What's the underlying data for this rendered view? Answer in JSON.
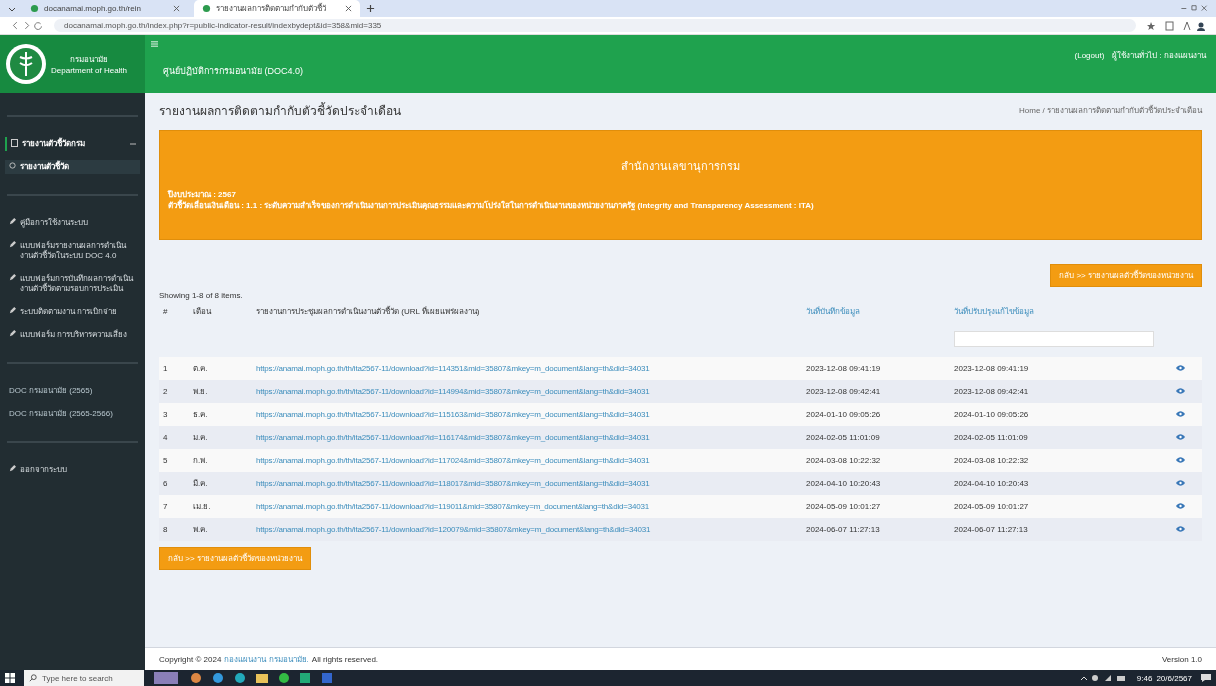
{
  "browser": {
    "tabs": [
      {
        "title": "docanamai.moph.go.th/rein",
        "selected": false
      },
      {
        "title": "รายงานผลการติดตามกำกับตัวชี้วั",
        "selected": true
      }
    ],
    "address": "docanamai.moph.go.th/index.php?r=public-indicator-result/indexbydept&id=358&mid=335"
  },
  "header": {
    "org_name": "กรมอนามัย",
    "org_name_en": "Department of Health",
    "app_title": "ศูนย์ปฏิบัติการกรมอนามัย (DOC4.0)",
    "logout": "(Logout)",
    "user": "ผู้ใช้งานทั่วไป : กองแผนงาน"
  },
  "sidebar": {
    "sections": [
      {
        "items": [
          {
            "label": "รายงานตัวชี้วัดกรม",
            "selected": false,
            "kind": "parent"
          },
          {
            "label": "รายงานตัวชี้วัด",
            "selected": true,
            "kind": "child"
          }
        ]
      },
      {
        "items": [
          {
            "label": "คู่มือการใช้งานระบบ",
            "selected": false,
            "kind": "link"
          },
          {
            "label": "แบบฟอร์มรายงานผลการดำเนินงานตัวชี้วัดในระบบ DOC 4.0",
            "selected": false,
            "kind": "link"
          },
          {
            "label": "แบบฟอร์มการบันทึกผลการดำเนินงานตัวชี้วัดตามรอบการประเมิน",
            "selected": false,
            "kind": "link"
          },
          {
            "label": "ระบบติดตามงาน การเบิกจ่าย",
            "selected": false,
            "kind": "link"
          },
          {
            "label": "แบบฟอร์ม การบริหารความเสี่ยง",
            "selected": false,
            "kind": "link"
          }
        ]
      },
      {
        "items": [
          {
            "label": "DOC กรมอนามัย (2565)",
            "selected": false,
            "kind": "plain"
          },
          {
            "label": "DOC กรมอนามัย (2565-2566)",
            "selected": false,
            "kind": "plain"
          }
        ]
      },
      {
        "items": [
          {
            "label": "ออกจากระบบ",
            "selected": false,
            "kind": "link"
          }
        ]
      }
    ]
  },
  "page": {
    "title": "รายงานผลการติดตามกำกับตัวชี้วัดประจำเดือน",
    "breadcrumb": "Home / รายงานผลการติดตามกำกับตัวชี้วัดประจำเดือน"
  },
  "banner": {
    "title": "สำนักงานเลขานุการกรม",
    "fiscal_year": "ปีงบประมาณ : 2567",
    "indicator": "ตัวชี้วัดเลื่อนเงินเดือน : 1.1 : ระดับความสำเร็จของการดำเนินงานการประเมินคุณธรรมและความโปร่งใสในการดำเนินงานของหน่วยงานภาครัฐ (Integrity and Transparency Assessment : ITA)"
  },
  "back_button_top": "กลับ >> รายงานผลตัวชี้วัดของหน่วยงาน",
  "summary": "Showing 1-8 of 8 items.",
  "table": {
    "columns": [
      "#",
      "เดือน",
      "รายงานการประชุมผลการดำเนินงานตัวชี้วัด (URL ที่เผยแพร่ผลงาน)",
      "วันที่บันทึกข้อมูล",
      "วันที่ปรับปรุงแก้ไขข้อมูล"
    ],
    "rows": [
      {
        "no": "1",
        "month": "ต.ค.",
        "url": "https://anamai.moph.go.th/th/ita2567-11/download?id=114351&mid=35807&mkey=m_document&lang=th&did=34031",
        "created": "2023-12-08 09:41:19",
        "updated": "2023-12-08 09:41:19"
      },
      {
        "no": "2",
        "month": "พ.ย.",
        "url": "https://anamai.moph.go.th/th/ita2567-11/download?id=114994&mid=35807&mkey=m_document&lang=th&did=34031",
        "created": "2023-12-08 09:42:41",
        "updated": "2023-12-08 09:42:41"
      },
      {
        "no": "3",
        "month": "ธ.ค.",
        "url": "https://anamai.moph.go.th/th/ita2567-11/download?id=115163&mid=35807&mkey=m_document&lang=th&did=34031",
        "created": "2024-01-10 09:05:26",
        "updated": "2024-01-10 09:05:26"
      },
      {
        "no": "4",
        "month": "ม.ค.",
        "url": "https://anamai.moph.go.th/th/ita2567-11/download?id=116174&mid=35807&mkey=m_document&lang=th&did=34031",
        "created": "2024-02-05 11:01:09",
        "updated": "2024-02-05 11:01:09"
      },
      {
        "no": "5",
        "month": "ก.พ.",
        "url": "https://anamai.moph.go.th/th/ita2567-11/download?id=117024&mid=35807&mkey=m_document&lang=th&did=34031",
        "created": "2024-03-08 10:22:32",
        "updated": "2024-03-08 10:22:32"
      },
      {
        "no": "6",
        "month": "มี.ค.",
        "url": "https://anamai.moph.go.th/th/ita2567-11/download?id=118017&mid=35807&mkey=m_document&lang=th&did=34031",
        "created": "2024-04-10 10:20:43",
        "updated": "2024-04-10 10:20:43"
      },
      {
        "no": "7",
        "month": "เม.ย.",
        "url": "https://anamai.moph.go.th/th/ita2567-11/download?id=119011&mid=35807&mkey=m_document&lang=th&did=34031",
        "created": "2024-05-09 10:01:27",
        "updated": "2024-05-09 10:01:27"
      },
      {
        "no": "8",
        "month": "พ.ค.",
        "url": "https://anamai.moph.go.th/th/ita2567-11/download?id=120079&mid=35807&mkey=m_document&lang=th&did=34031",
        "created": "2024-06-07 11:27:13",
        "updated": "2024-06-07 11:27:13"
      }
    ]
  },
  "back_button_bottom": "กลับ >> รายงานผลตัวชี้วัดของหน่วยงาน",
  "footer": {
    "copyright": "Copyright © 2024",
    "owner": "กองแผนงาน กรมอนามัย.",
    "rights": "All rights reserved.",
    "version": "Version 1.0"
  },
  "taskbar": {
    "search_placeholder": "Type here to search",
    "time": "9:46",
    "date": "20/6/2567"
  }
}
